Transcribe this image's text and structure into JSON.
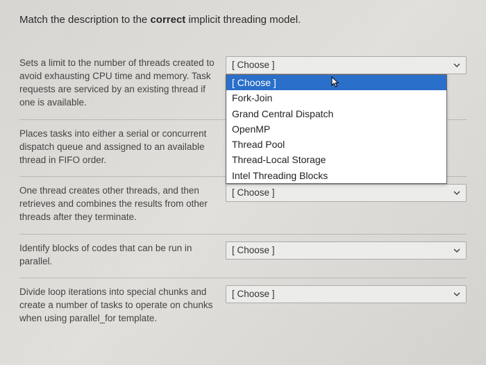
{
  "question": {
    "prefix": "Match the description to the ",
    "bold": "correct",
    "suffix": " implicit threading model."
  },
  "placeholder": "[ Choose ]",
  "rows": [
    {
      "desc": "Sets a limit to the number of threads created to avoid exhausting CPU time and memory. Task requests are serviced by an existing thread if one is available."
    },
    {
      "desc": "Places tasks into either a serial or concurrent dispatch queue and assigned to an available thread in FIFO order."
    },
    {
      "desc": "One thread creates other threads, and then retrieves and combines the results from other threads after they terminate."
    },
    {
      "desc": "Identify blocks of codes that can be run in parallel."
    },
    {
      "desc": "Divide loop iterations into special chunks and create a number of tasks to operate on chunks when using parallel_for template."
    }
  ],
  "dropdown": {
    "options": [
      "[ Choose ]",
      "Fork-Join",
      "Grand Central Dispatch",
      "OpenMP",
      "Thread Pool",
      "Thread-Local Storage",
      "Intel Threading Blocks"
    ],
    "highlightedIndex": 0
  }
}
